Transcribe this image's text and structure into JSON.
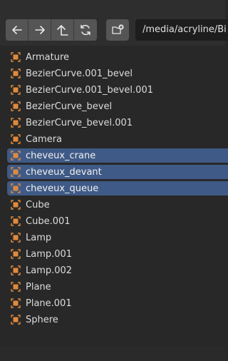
{
  "toolbar": {
    "back_icon": "arrow-left-icon",
    "forward_icon": "arrow-right-icon",
    "parent_icon": "arrow-up-icon",
    "refresh_icon": "refresh-icon",
    "new_folder_icon": "new-folder-icon",
    "path": "/media/acryline/Bi"
  },
  "items": [
    {
      "label": "Armature",
      "selected": false
    },
    {
      "label": "BezierCurve.001_bevel",
      "selected": false
    },
    {
      "label": "BezierCurve.001_bevel.001",
      "selected": false
    },
    {
      "label": "BezierCurve_bevel",
      "selected": false
    },
    {
      "label": "BezierCurve_bevel.001",
      "selected": false
    },
    {
      "label": "Camera",
      "selected": false
    },
    {
      "label": "cheveux_crane",
      "selected": true
    },
    {
      "label": "cheveux_devant",
      "selected": true
    },
    {
      "label": "cheveux_queue",
      "selected": true
    },
    {
      "label": "Cube",
      "selected": false
    },
    {
      "label": "Cube.001",
      "selected": false
    },
    {
      "label": "Lamp",
      "selected": false
    },
    {
      "label": "Lamp.001",
      "selected": false
    },
    {
      "label": "Lamp.002",
      "selected": false
    },
    {
      "label": "Plane",
      "selected": false
    },
    {
      "label": "Plane.001",
      "selected": false
    },
    {
      "label": "Sphere",
      "selected": false
    }
  ],
  "colors": {
    "selection": "#3f5a86",
    "object_icon": "#e08a3c"
  }
}
